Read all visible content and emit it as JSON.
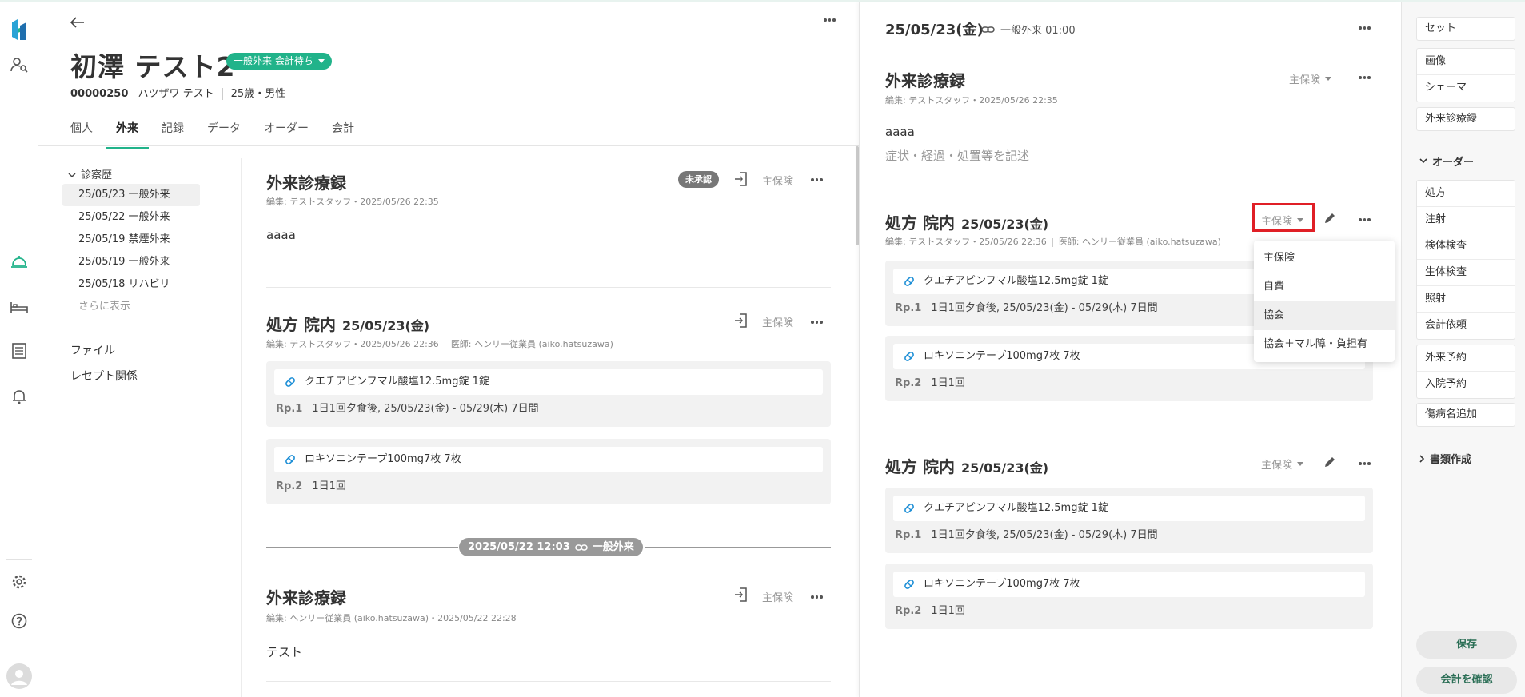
{
  "patient": {
    "name": "初澤 テスト2",
    "status_badge": "一般外来 会計待ち",
    "id": "00000250",
    "kana": "ハツザワ テスト",
    "age_sex": "25歳・男性"
  },
  "tabs": [
    "個人",
    "外来",
    "記録",
    "データ",
    "オーダー",
    "会計"
  ],
  "active_tab": "外来",
  "history": {
    "header": "診察歴",
    "items": [
      "25/05/23 一般外来",
      "25/05/22 一般外来",
      "25/05/19 禁煙外来",
      "25/05/19 一般外来",
      "25/05/18 リハビリ"
    ],
    "more": "さらに表示",
    "links": [
      "ファイル",
      "レセプト関係"
    ]
  },
  "main": {
    "record1": {
      "title": "外来診療録",
      "badge": "未承認",
      "insurance": "主保険",
      "meta": "編集: テストスタッフ・2025/05/26 22:35",
      "body": "aaaa"
    },
    "rx1": {
      "title": "処方 院内",
      "date": "25/05/23(金)",
      "insurance": "主保険",
      "meta_editor": "編集: テストスタッフ・2025/05/26 22:36",
      "meta_doctor": "医師: ヘンリー従業員 (aiko.hatsuzawa)",
      "drug1": "クエチアピンフマル酸塩12.5mg錠 1錠",
      "rp1_label": "Rp.1",
      "rp1": "1日1回夕食後, 25/05/23(金) - 05/29(木) 7日間",
      "drug2": "ロキソニンテープ100mg7枚 7枚",
      "rp2_label": "Rp.2",
      "rp2": "1日1回"
    },
    "separator": {
      "datetime": "2025/05/22 12:03",
      "visit": "一般外来"
    },
    "record2": {
      "title": "外来診療録",
      "insurance": "主保険",
      "meta": "編集: ヘンリー従業員 (aiko.hatsuzawa)・2025/05/22 22:28",
      "body": "テスト"
    }
  },
  "right": {
    "date": "25/05/23(金)",
    "visit": "一般外来 01:00",
    "record": {
      "title": "外来診療録",
      "insurance": "主保険",
      "meta": "編集: テストスタッフ・2025/05/26 22:35",
      "body": "aaaa",
      "placeholder": "症状・経過・処置等を記述"
    },
    "rx1": {
      "title": "処方 院内",
      "date": "25/05/23(金)",
      "insurance": "主保険",
      "meta_editor": "編集: テストスタッフ・25/05/26 22:36",
      "meta_doctor": "医師: ヘンリー従業員 (aiko.hatsuzawa)",
      "drug1": "クエチアピンフマル酸塩12.5mg錠 1錠",
      "rp1_label": "Rp.1",
      "rp1": "1日1回夕食後, 25/05/23(金) - 05/29(木) 7日間",
      "drug2": "ロキソニンテープ100mg7枚 7枚",
      "rp2_label": "Rp.2",
      "rp2": "1日1回"
    },
    "rx2": {
      "title": "処方 院内",
      "date": "25/05/23(金)",
      "insurance": "主保険",
      "drug1": "クエチアピンフマル酸塩12.5mg錠 1錠",
      "rp1_label": "Rp.1",
      "rp1": "1日1回夕食後, 25/05/23(金) - 05/29(木) 7日間",
      "drug2": "ロキソニンテープ100mg7枚 7枚",
      "rp2_label": "Rp.2",
      "rp2": "1日1回"
    },
    "dropdown": [
      "主保険",
      "自費",
      "協会",
      "協会＋マル障・負担有"
    ],
    "dropdown_highlighted": "協会"
  },
  "sidebar": {
    "set": "セット",
    "image": "画像",
    "schema": "シェーマ",
    "outpatient_record": "外来診療録",
    "order_header": "オーダー",
    "orders": [
      "処方",
      "注射",
      "検体検査",
      "生体検査",
      "照射",
      "会計依頼"
    ],
    "reservations": [
      "外来予約",
      "入院予約"
    ],
    "disease": "傷病名追加",
    "docs_header": "書類作成",
    "save": "保存",
    "confirm": "会計を確認"
  },
  "colors": {
    "accent": "#21b38a",
    "highlight_box": "#e01f26"
  }
}
